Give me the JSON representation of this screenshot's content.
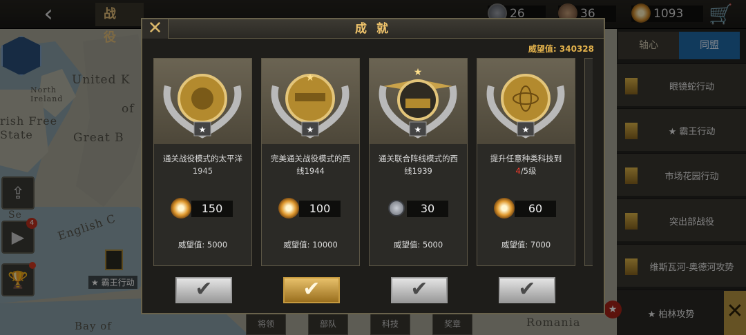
{
  "topbar": {
    "title": "战 役",
    "back_icon": "back-arrow-icon",
    "currencies": [
      {
        "icon": "silver-medal-icon",
        "value": "26"
      },
      {
        "icon": "bronze-medal-icon",
        "value": "36"
      },
      {
        "icon": "sun-coin-icon",
        "value": "1093"
      }
    ],
    "cart_icon": "cart-icon"
  },
  "map_labels": {
    "united_k": "United K",
    "north_ireland": "North\nIreland",
    "of": "of",
    "irish_free_state": "rish Free\nState",
    "great_b": "Great B",
    "sea": "Se",
    "english_c": "English C",
    "bay_of": "Bay of",
    "romania": "Romania"
  },
  "left_controls": {
    "share_icon": "share-icon",
    "video_icon": "video-icon",
    "video_badge": "4",
    "trophy_icon": "trophy-icon"
  },
  "map_marker_label": "★ 霸王行动",
  "right_panel": {
    "tabs": {
      "axis": "轴心",
      "allies": "同盟"
    },
    "operations": [
      "眼镜蛇行动",
      "★ 霸王行动",
      "市场花园行动",
      "突出部战役",
      "维斯瓦河-奥德河攻势"
    ],
    "active_operation": "★ 柏林攻势"
  },
  "bottom_menu": [
    "将领",
    "部队",
    "科技",
    "奖章"
  ],
  "dialog": {
    "title": "成 就",
    "close_icon": "close-x-icon",
    "prestige_total": "威望值: 340328",
    "cards": [
      {
        "art": "gold-medal-pacific",
        "desc_line1": "通关战役模式的太平洋",
        "desc_line2": "1945",
        "reward_icon": "sun-coin-icon",
        "reward": "150",
        "prestige": "威望值: 5000",
        "claim_state": "silver"
      },
      {
        "art": "gold-medal-west-front",
        "desc_line1": "完美通关战役模式的西",
        "desc_line2": "线1944",
        "reward_icon": "sun-coin-icon",
        "reward": "100",
        "prestige": "威望值: 10000",
        "claim_state": "gold"
      },
      {
        "art": "gold-medal-tank",
        "desc_line1": "通关联合阵线模式的西",
        "desc_line2": "线1939",
        "reward_icon": "silver-medal-icon",
        "reward": "30",
        "prestige": "威望值: 5000",
        "claim_state": "silver"
      },
      {
        "art": "gold-medal-atom",
        "desc_line1": "提升任意种类科技到",
        "desc_prefix": "4",
        "desc_suffix": "/5级",
        "reward_icon": "sun-coin-icon",
        "reward": "60",
        "prestige": "威望值: 7000",
        "claim_state": "silver"
      }
    ]
  }
}
